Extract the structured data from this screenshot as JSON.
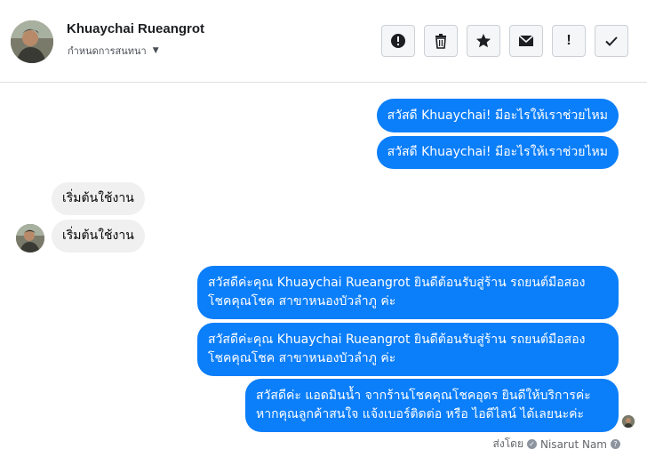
{
  "header": {
    "contact_name": "Khuaychai Rueangrot",
    "assign_label": "กำหนดการสนทนา",
    "toolbar": {
      "spam_icon": "alert-circle-icon",
      "delete_icon": "trash-icon",
      "star_icon": "star-icon",
      "mark_unread_icon": "envelope-icon",
      "follow_up_label": "!",
      "done_icon": "check-icon"
    }
  },
  "messages": [
    {
      "direction": "outgoing",
      "text": "สวัสดี Khuaychai! มีอะไรให้เราช่วยไหม"
    },
    {
      "direction": "outgoing",
      "text": "สวัสดี Khuaychai! มีอะไรให้เราช่วยไหม"
    },
    {
      "direction": "incoming",
      "text": "เริ่มต้นใช้งาน"
    },
    {
      "direction": "incoming",
      "text": "เริ่มต้นใช้งาน"
    },
    {
      "direction": "outgoing",
      "lines": [
        "สวัสดีค่ะคุณ Khuaychai Rueangrot ยินดีต้อนรับสู่ร้าน รถยนต์มือสอง",
        "โชคคุณโชค สาขาหนองบัวลำภู ค่ะ"
      ]
    },
    {
      "direction": "outgoing",
      "lines": [
        "สวัสดีค่ะคุณ Khuaychai Rueangrot ยินดีต้อนรับสู่ร้าน รถยนต์มือสอง",
        "โชคคุณโชค สาขาหนองบัวลำภู ค่ะ"
      ]
    },
    {
      "direction": "outgoing",
      "lines": [
        "สวัสดีค่ะ แอดมินน้ำ จากร้านโชคคุณโชคอุดร ยินดีให้บริการค่ะ",
        "หากคุณลูกค้าสนใจ แจ้งเบอร์ติดต่อ หรือ ไอดีไลน์ ได้เลยนะค่ะ"
      ]
    }
  ],
  "sent_by": {
    "label": "ส่งโดย",
    "sender": "Nisarut Nam"
  },
  "colors": {
    "outgoing_bubble": "#0b7ef9",
    "incoming_bubble": "#f0f0f0"
  }
}
